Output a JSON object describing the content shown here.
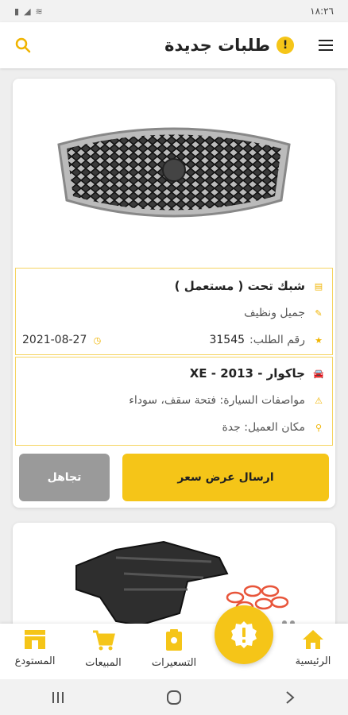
{
  "status_bar": {
    "time": "١٨:٢٦"
  },
  "header": {
    "title": "طلبات جديدة",
    "badge": "!"
  },
  "request": {
    "part_name": "شبك تحت ( مستعمل )",
    "condition": "جميل ونظيف",
    "order_label": "رقم الطلب:",
    "order_number": "31545",
    "date": "2021-08-27",
    "car": "جاكوار - XE - 2013",
    "specs": "مواصفات السيارة: فتحة سقف، سوداء",
    "location": "مكان العميل: جدة",
    "send_quote_label": "ارسال عرض سعر",
    "ignore_label": "تجاهل"
  },
  "bottom_nav": {
    "items": [
      {
        "label": "الرئيسية",
        "icon": "home-icon"
      },
      {
        "label": "التسعيرات",
        "icon": "quotes-icon"
      },
      {
        "label": "المبيعات",
        "icon": "cart-icon"
      },
      {
        "label": "المستودع",
        "icon": "warehouse-icon"
      }
    ],
    "fab_icon": "alert-badge-icon"
  },
  "colors": {
    "accent": "#f5c518",
    "ignore": "#9a9a9a"
  }
}
